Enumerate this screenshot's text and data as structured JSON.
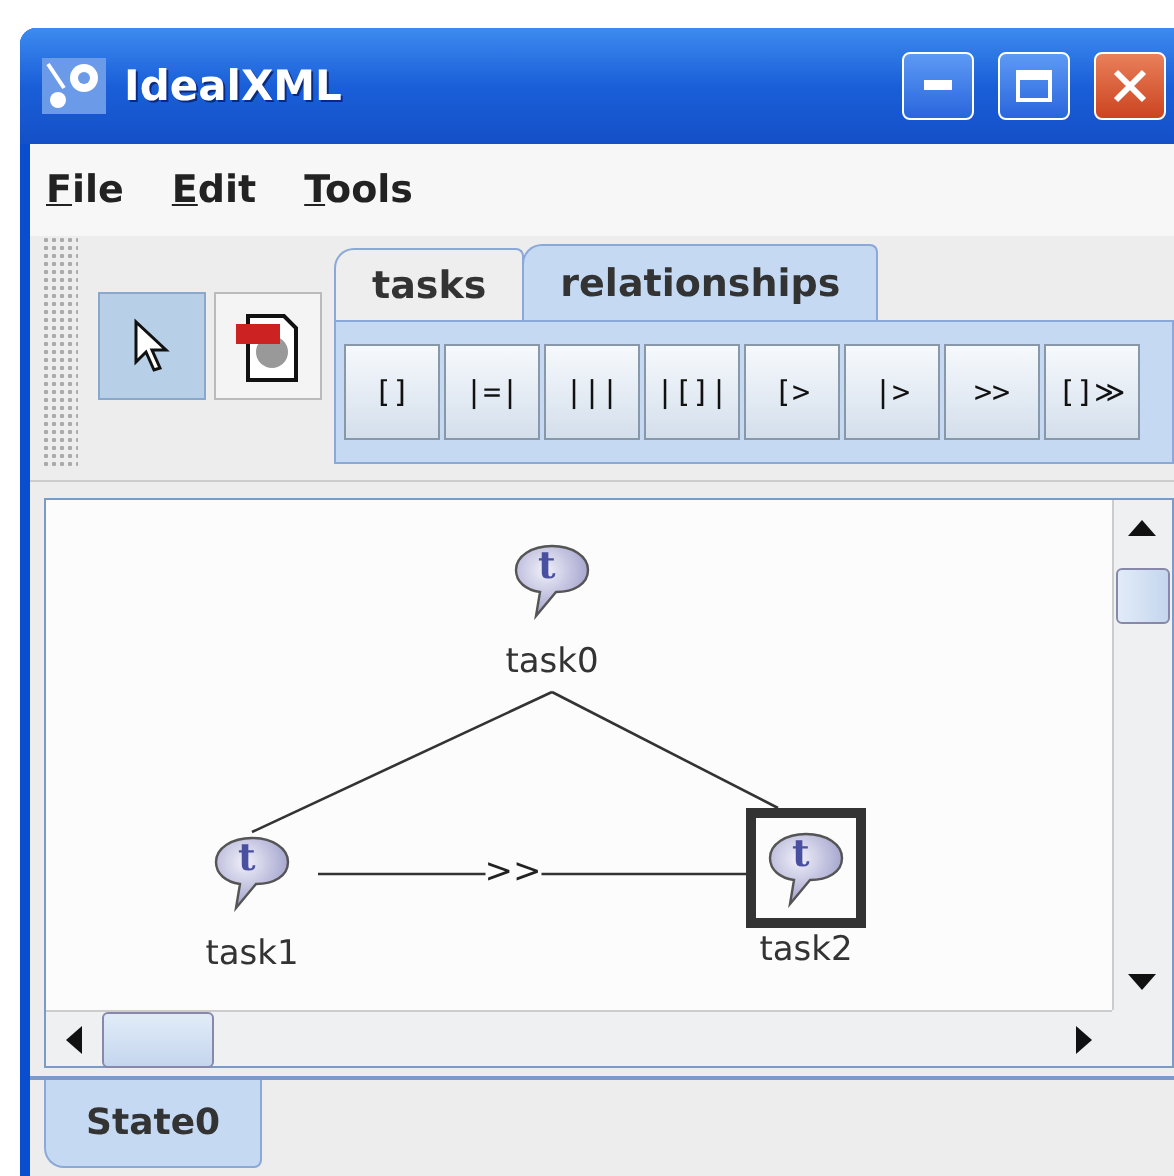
{
  "window": {
    "title": "IdealXML"
  },
  "menu": [
    {
      "label": "File"
    },
    {
      "label": "Edit"
    },
    {
      "label": "Tools"
    }
  ],
  "tools": [
    {
      "kind": "pointer",
      "selected": true
    },
    {
      "kind": "jpg",
      "selected": false
    }
  ],
  "tabs": [
    {
      "label": "tasks",
      "selected": false
    },
    {
      "label": "relationships",
      "selected": true
    }
  ],
  "operators": [
    "[]",
    "|=|",
    "|||",
    "|[]|",
    "[>",
    "|>",
    ">>",
    "[]≫"
  ],
  "root": {
    "label": "task0",
    "icon_letter": "t",
    "selected": false,
    "children": [
      {
        "label": "task1",
        "icon_letter": "t",
        "selected": false,
        "relation_to_next": ">>"
      },
      {
        "label": "task2",
        "icon_letter": "t",
        "selected": true
      }
    ]
  },
  "state_tabs": [
    {
      "label": "State0",
      "selected": true
    }
  ]
}
